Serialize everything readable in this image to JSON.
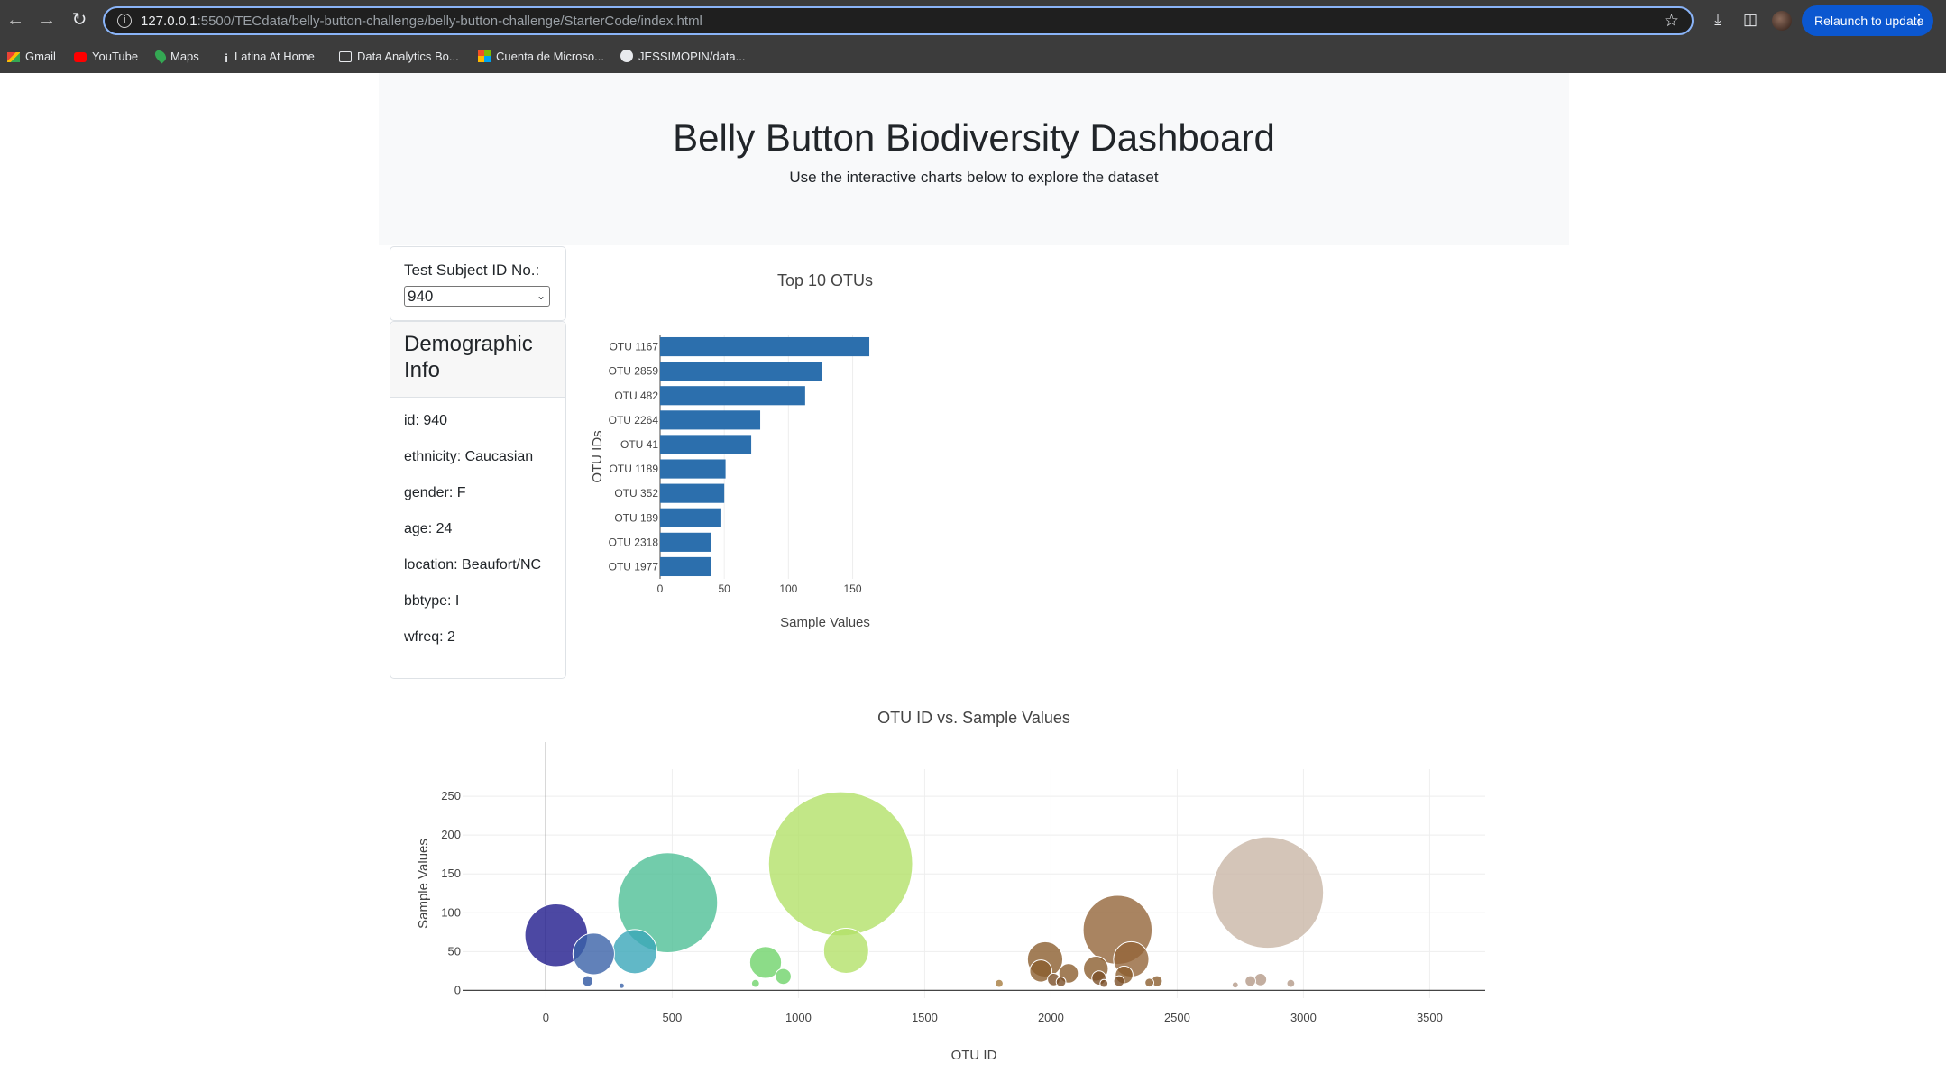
{
  "browser": {
    "url_host": "127.0.0.1",
    "url_rest": ":5500/TECdata/belly-button-challenge/belly-button-challenge/StarterCode/index.html",
    "relaunch_label": "Relaunch to update",
    "bookmarks": [
      "Gmail",
      "YouTube",
      "Maps",
      "Latina At Home",
      "Data Analytics Bo...",
      "Cuenta de Microso...",
      "JESSIMOPIN/data..."
    ]
  },
  "header": {
    "title": "Belly Button Biodiversity Dashboard",
    "subtitle": "Use the interactive charts below to explore the dataset"
  },
  "selector": {
    "label": "Test Subject ID No.:",
    "selected": "940"
  },
  "demographics": {
    "title": "Demographic Info",
    "rows": [
      "id: 940",
      "ethnicity: Caucasian",
      "gender: F",
      "age: 24",
      "location: Beaufort/NC",
      "bbtype: I",
      "wfreq: 2"
    ]
  },
  "chart_data": [
    {
      "type": "bar",
      "orientation": "horizontal",
      "title": "Top 10 OTUs",
      "xlabel": "Sample Values",
      "ylabel": "OTU IDs",
      "categories": [
        "OTU 1167",
        "OTU 2859",
        "OTU 482",
        "OTU 2264",
        "OTU 41",
        "OTU 1189",
        "OTU 352",
        "OTU 189",
        "OTU 2318",
        "OTU 1977"
      ],
      "values": [
        163,
        126,
        113,
        78,
        71,
        51,
        50,
        47,
        40,
        40
      ],
      "xlim": [
        0,
        170
      ],
      "xticks": [
        0,
        50,
        100,
        150
      ],
      "color": "#2c6fad",
      "grid": true
    },
    {
      "type": "scatter",
      "subtype": "bubble",
      "title": "OTU ID vs. Sample Values",
      "xlabel": "OTU ID",
      "ylabel": "Sample Values",
      "xlim": [
        -330,
        3720
      ],
      "ylim": [
        -10,
        285
      ],
      "xticks": [
        0,
        500,
        1000,
        1500,
        2000,
        2500,
        3000,
        3500
      ],
      "yticks": [
        0,
        50,
        100,
        150,
        200,
        250
      ],
      "grid": true,
      "points": [
        {
          "x": 41,
          "y": 71,
          "color": "#1f1a8c"
        },
        {
          "x": 189,
          "y": 47,
          "color": "#3a62a8"
        },
        {
          "x": 165,
          "y": 12,
          "color": "#2d55a0"
        },
        {
          "x": 300,
          "y": 6,
          "color": "#3a62a8"
        },
        {
          "x": 352,
          "y": 50,
          "color": "#3aa6b9"
        },
        {
          "x": 482,
          "y": 113,
          "color": "#4fbf96"
        },
        {
          "x": 870,
          "y": 36,
          "color": "#6fd36a"
        },
        {
          "x": 940,
          "y": 18,
          "color": "#6fd36a"
        },
        {
          "x": 830,
          "y": 9,
          "color": "#6fd36a"
        },
        {
          "x": 1167,
          "y": 163,
          "color": "#b3e169"
        },
        {
          "x": 1189,
          "y": 51,
          "color": "#b3e169"
        },
        {
          "x": 1795,
          "y": 9,
          "color": "#a67c3e"
        },
        {
          "x": 1977,
          "y": 40,
          "color": "#8b5e2e"
        },
        {
          "x": 1960,
          "y": 25,
          "color": "#8b5e2e"
        },
        {
          "x": 2011,
          "y": 14,
          "color": "#7b4f28"
        },
        {
          "x": 2040,
          "y": 11,
          "color": "#7b4f28"
        },
        {
          "x": 2070,
          "y": 22,
          "color": "#8b5e2e"
        },
        {
          "x": 2178,
          "y": 28,
          "color": "#8b5e2e"
        },
        {
          "x": 2190,
          "y": 16,
          "color": "#7b4f28"
        },
        {
          "x": 2210,
          "y": 9,
          "color": "#7b4f28"
        },
        {
          "x": 2264,
          "y": 78,
          "color": "#94653a"
        },
        {
          "x": 2318,
          "y": 40,
          "color": "#94653a"
        },
        {
          "x": 2290,
          "y": 20,
          "color": "#8b5e2e"
        },
        {
          "x": 2270,
          "y": 12,
          "color": "#7b4f28"
        },
        {
          "x": 2390,
          "y": 10,
          "color": "#8b5e2e"
        },
        {
          "x": 2420,
          "y": 12,
          "color": "#8b5e2e"
        },
        {
          "x": 2730,
          "y": 7,
          "color": "#b49a88"
        },
        {
          "x": 2790,
          "y": 12,
          "color": "#b49a88"
        },
        {
          "x": 2830,
          "y": 14,
          "color": "#b49a88"
        },
        {
          "x": 2859,
          "y": 126,
          "color": "#c9b7a6"
        },
        {
          "x": 2950,
          "y": 9,
          "color": "#b49a88"
        }
      ]
    }
  ]
}
